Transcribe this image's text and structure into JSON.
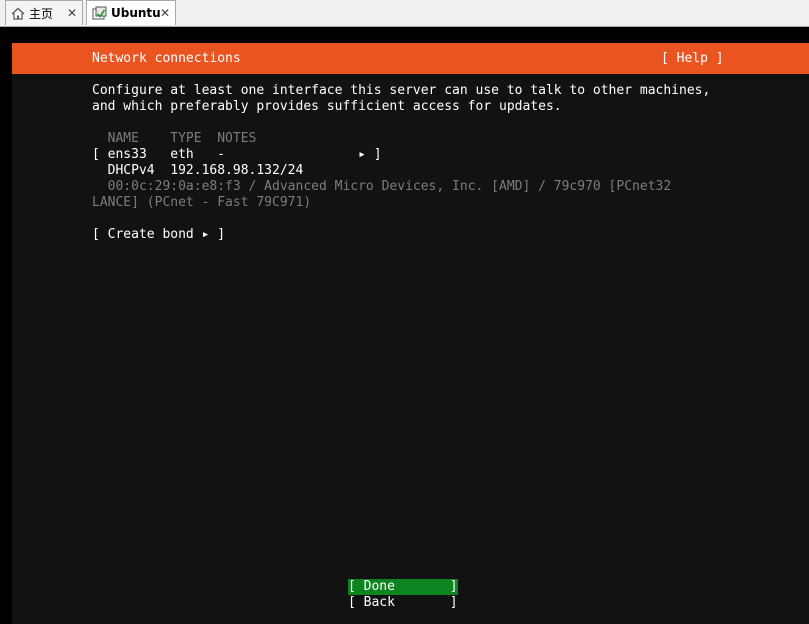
{
  "tabs": [
    {
      "label": "主页",
      "icon": "home-icon",
      "close": "✕"
    },
    {
      "label": "Ubuntu",
      "icon": "vm-icon",
      "close": "✕"
    }
  ],
  "installer": {
    "title": "Network connections",
    "help": "[ Help ]",
    "description": [
      "Configure at least one interface this server can use to talk to other machines,",
      "and which preferably provides sufficient access for updates."
    ],
    "table_header": "  NAME    TYPE  NOTES",
    "interface_row": "[ ens33   eth   -                 ▸ ]",
    "dhcp_row": "  DHCPv4  192.168.98.132/24",
    "device_info": [
      "  00:0c:29:0a:e8:f3 / Advanced Micro Devices, Inc. [AMD] / 79c970 [PCnet32",
      "LANCE] (PCnet - Fast 79C971)"
    ],
    "create_bond": "[ Create bond ▸ ]",
    "done_button": "[ Done       ]",
    "back_button": "[ Back       ]"
  },
  "colors": {
    "accent": "#e95420",
    "done_highlight": "#0e8420",
    "console_bg": "#121212"
  }
}
